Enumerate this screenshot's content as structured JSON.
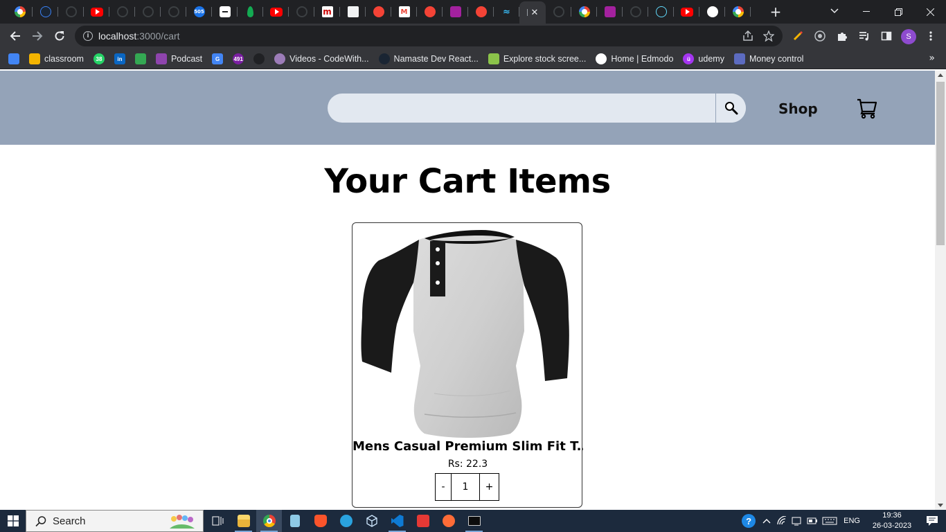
{
  "browser": {
    "tabs": [
      {
        "icon": "google-icon"
      },
      {
        "icon": "dark-blue-icon"
      },
      {
        "icon": "github-icon"
      },
      {
        "icon": "youtube-icon"
      },
      {
        "icon": "github-icon"
      },
      {
        "icon": "github-icon"
      },
      {
        "icon": "github-icon"
      },
      {
        "icon": "calendar-icon",
        "badge": "505"
      },
      {
        "icon": "notes-icon"
      },
      {
        "icon": "mongodb-icon"
      },
      {
        "icon": "youtube-icon"
      },
      {
        "icon": "github-icon"
      },
      {
        "icon": "m-icon"
      },
      {
        "icon": "doc-icon"
      },
      {
        "icon": "rocket-icon"
      },
      {
        "icon": "gmail-icon"
      },
      {
        "icon": "rocket-icon"
      },
      {
        "icon": "purple-icon"
      },
      {
        "icon": "rocket-icon"
      },
      {
        "icon": "tailwind-icon"
      }
    ],
    "active_tab_close": "✕",
    "tabs_after": [
      {
        "icon": "github-icon"
      },
      {
        "icon": "google-icon"
      },
      {
        "icon": "purple-icon"
      },
      {
        "icon": "github-icon"
      },
      {
        "icon": "react-icon"
      },
      {
        "icon": "youtube-icon"
      },
      {
        "icon": "globe-icon"
      },
      {
        "icon": "google-icon"
      }
    ],
    "new_tab": "+",
    "url_host": "localhost",
    "url_path": ":3000/cart",
    "profile_initial": "S",
    "bookmarks": [
      {
        "label": "",
        "icon": "multicolor-icon",
        "color": "#4285f4"
      },
      {
        "label": "classroom",
        "icon": "classroom-icon",
        "color": "#f4b400"
      },
      {
        "label": "",
        "icon": "whatsapp-icon",
        "color": "#25d366",
        "badge": "38"
      },
      {
        "label": "",
        "icon": "linkedin-icon",
        "color": "#0a66c2",
        "badge": "in"
      },
      {
        "label": "",
        "icon": "drive-icon",
        "color": "#34a853"
      },
      {
        "label": "Podcast",
        "icon": "podcast-icon",
        "color": "#8e44ad"
      },
      {
        "label": "",
        "icon": "gemail-icon",
        "color": "#4285f4",
        "badge": "G"
      },
      {
        "label": "",
        "icon": "badge-icon",
        "color": "#7b1fa2",
        "badge": "491"
      },
      {
        "label": "",
        "icon": "github-icon",
        "color": "#202124"
      },
      {
        "label": "Videos - CodeWith...",
        "icon": "avatar-icon",
        "color": "#9c7cb8"
      },
      {
        "label": "Namaste Dev React...",
        "icon": "namaste-icon",
        "color": "#1a2533"
      },
      {
        "label": "Explore stock scree...",
        "icon": "bars-icon",
        "color": "#8bc34a"
      },
      {
        "label": "Home | Edmodo",
        "icon": "globe-icon",
        "color": "#ffffff"
      },
      {
        "label": "udemy",
        "icon": "udemy-icon",
        "color": "#a435f0",
        "badge": "ü"
      },
      {
        "label": "Money control",
        "icon": "moneycontrol-icon",
        "color": "#5c6bc0"
      }
    ],
    "bookmarks_more": "»"
  },
  "site": {
    "search_placeholder": "",
    "shop_label": "Shop",
    "cart_title": "Your Cart Items",
    "cart_items": [
      {
        "name": "Mens Casual Premium Slim Fit T...",
        "price_label": "Rs: 22.3",
        "quantity": "1",
        "minus": "-",
        "plus": "+"
      }
    ]
  },
  "taskbar": {
    "search_label": "Search",
    "apps": [
      "task-view-icon",
      "file-explorer-icon",
      "chrome-icon",
      "notepad-icon",
      "brave-icon",
      "telegram-icon",
      "3d-box-icon",
      "vscode-icon",
      "wps-icon",
      "postman-icon",
      "terminal-icon"
    ],
    "lang": "ENG",
    "time": "19:36",
    "date": "26-03-2023"
  },
  "colors": {
    "header_bg": "#94a3b8",
    "search_bg": "#e2e8f0",
    "browser_dark": "#202124",
    "browser_toolbar": "#35363a",
    "taskbar_bg": "#1c2a3d"
  }
}
